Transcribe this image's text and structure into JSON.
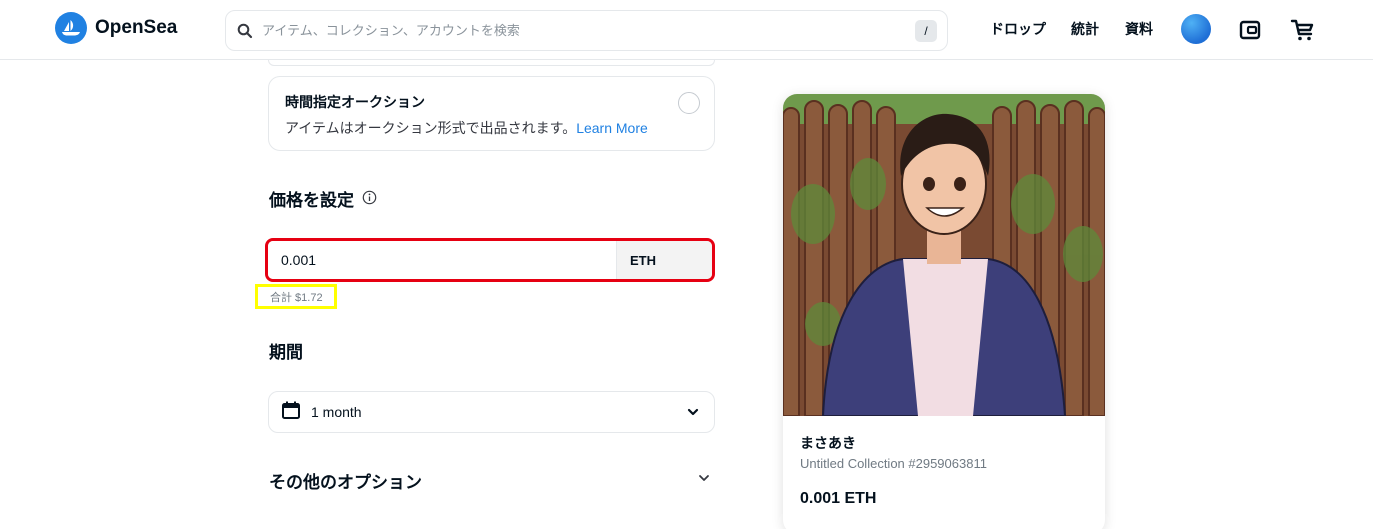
{
  "header": {
    "logo_text": "OpenSea",
    "search_placeholder": "アイテム、コレクション、アカウントを検索",
    "search_shortcut": "/",
    "nav": [
      "ドロップ",
      "統計",
      "資料"
    ]
  },
  "listing": {
    "auction_title": "時間指定オークション",
    "auction_desc": "アイテムはオークション形式で出品されます。",
    "learn_more": "Learn More",
    "price_heading": "価格を設定",
    "price_value": "0.001",
    "currency": "ETH",
    "total": "合計 $1.72",
    "duration_heading": "期間",
    "duration_value": "1 month",
    "more_options": "その他のオプション"
  },
  "preview": {
    "name": "まさあき",
    "collection": "Untitled Collection #2959063811",
    "price": "0.001 ETH"
  },
  "colors": {
    "accent": "#2081e2",
    "highlight_red": "#e60012",
    "highlight_yellow": "#ffff00"
  }
}
